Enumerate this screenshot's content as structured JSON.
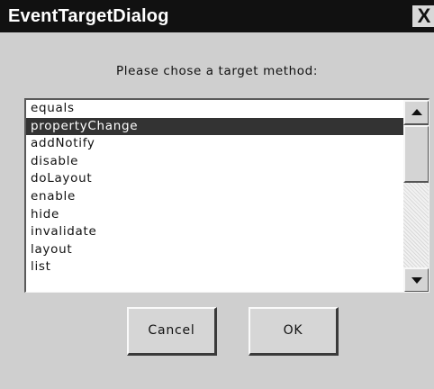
{
  "window": {
    "title": "EventTargetDialog",
    "close_glyph": "X"
  },
  "prompt": "Please chose a target method:",
  "list": {
    "items": [
      "equals",
      "propertyChange",
      "addNotify",
      "disable",
      "doLayout",
      "enable",
      "hide",
      "invalidate",
      "layout",
      "list"
    ],
    "selected": "propertyChange"
  },
  "buttons": {
    "cancel_label": "Cancel",
    "ok_label": "OK"
  },
  "colors": {
    "titlebar": "#111111",
    "dialog_background": "#cfcfcf",
    "selection": "#333333"
  },
  "icons": {
    "close": "close-icon",
    "scroll_up": "scroll-up-arrow-icon",
    "scroll_down": "scroll-down-arrow-icon"
  }
}
